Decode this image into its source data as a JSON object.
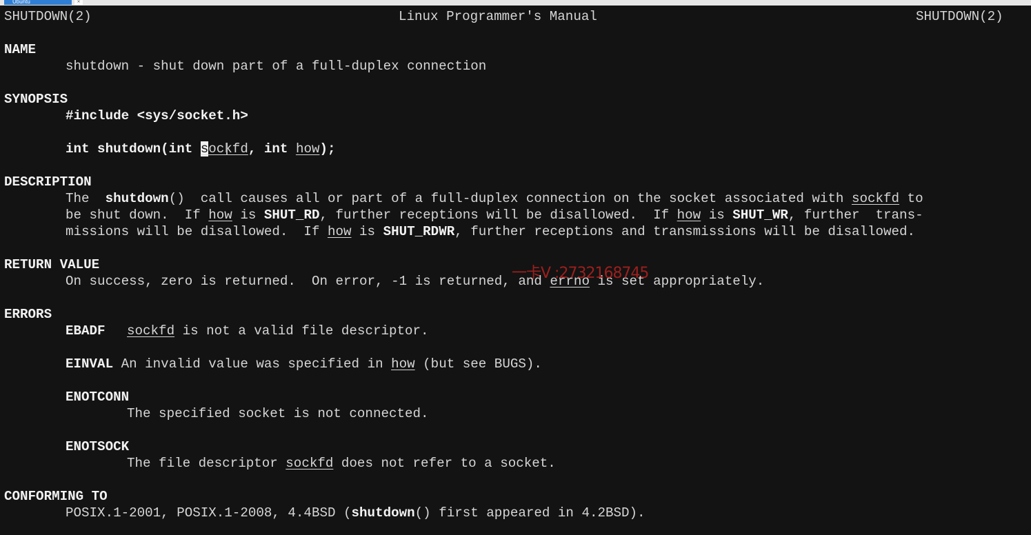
{
  "window": {
    "tab_label": "Ubuntu",
    "tab_close": "×"
  },
  "page": {
    "header_left": "SHUTDOWN(2)",
    "header_center": "Linux Programmer's Manual",
    "header_right": "SHUTDOWN(2)"
  },
  "name": {
    "heading": "NAME",
    "text": "shutdown - shut down part of a full-duplex connection"
  },
  "synopsis": {
    "heading": "SYNOPSIS",
    "include": "#include <sys/socket.h>",
    "proto_1": "int shutdown(int ",
    "cursor_char": "s",
    "arg_rest": "ockfd",
    "proto_2": ", int ",
    "arg_how": "how",
    "proto_end": ");"
  },
  "description": {
    "heading": "DESCRIPTION",
    "l1_a": "The  ",
    "l1_fn": "shutdown",
    "l1_b": "()  call causes all or part of a full-duplex connection on the socket associated with ",
    "l1_arg": "sockfd",
    "l1_c": " to",
    "l2_a": "be shut down.  If ",
    "l2_how": "how",
    "l2_b": " is ",
    "l2_rd": "SHUT_RD",
    "l2_c": ", further receptions will be disallowed.  If ",
    "l2_how2": "how",
    "l2_d": " is ",
    "l2_wr": "SHUT_WR",
    "l2_e": ", further  trans‐",
    "l3_a": "missions will be disallowed.  If ",
    "l3_how": "how",
    "l3_b": " is ",
    "l3_rdwr": "SHUT_RDWR",
    "l3_c": ", further receptions and transmissions will be disallowed."
  },
  "return_value": {
    "heading": "RETURN VALUE",
    "a": "On success, zero is returned.  On error, -1 is returned, and ",
    "errno": "errno",
    "b": " is set appropriately."
  },
  "errors": {
    "heading": "ERRORS",
    "ebadf_name": "EBADF",
    "ebadf_arg": "sockfd",
    "ebadf_text": " is not a valid file descriptor.",
    "einval_name": "EINVAL",
    "einval_a": " An invalid value was specified in ",
    "einval_how": "how",
    "einval_b": " (but see BUGS).",
    "enotconn_name": "ENOTCONN",
    "enotconn_text": "The specified socket is not connected.",
    "enotsock_name": "ENOTSOCK",
    "enotsock_a": "The file descriptor ",
    "enotsock_arg": "sockfd",
    "enotsock_b": " does not refer to a socket."
  },
  "conforming": {
    "heading": "CONFORMING TO",
    "a": "POSIX.1-2001, POSIX.1-2008, 4.4BSD (",
    "fn": "shutdown",
    "b": "() first appeared in 4.2BSD)."
  },
  "watermark": {
    "text": "一卡V :2732168745"
  }
}
